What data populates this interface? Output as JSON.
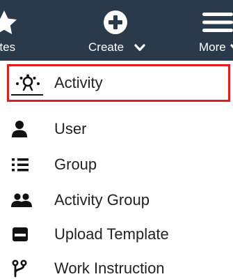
{
  "topbar": {
    "items": [
      {
        "label": "vorites",
        "icon": "star-icon"
      },
      {
        "label": "Create",
        "icon": "plus-circle-icon",
        "chevron": "chevron-down-icon"
      },
      {
        "label": "More",
        "icon": "hamburger-icon",
        "chevron": "chevron-down-icon"
      }
    ],
    "background": "#2b3a4a",
    "text_color": "#ffffff"
  },
  "menu": {
    "items": [
      {
        "label": "Activity",
        "icon": "activity-icon",
        "selected": true
      },
      {
        "label": "User",
        "icon": "user-icon",
        "selected": false
      },
      {
        "label": "Group",
        "icon": "list-icon",
        "selected": false
      },
      {
        "label": "Activity Group",
        "icon": "users-icon",
        "selected": false
      },
      {
        "label": "Upload Template",
        "icon": "template-icon",
        "selected": false
      },
      {
        "label": "Work Instruction",
        "icon": "branch-icon",
        "selected": false
      }
    ],
    "highlight_color": "#e21b1b",
    "text_color": "#222222"
  }
}
